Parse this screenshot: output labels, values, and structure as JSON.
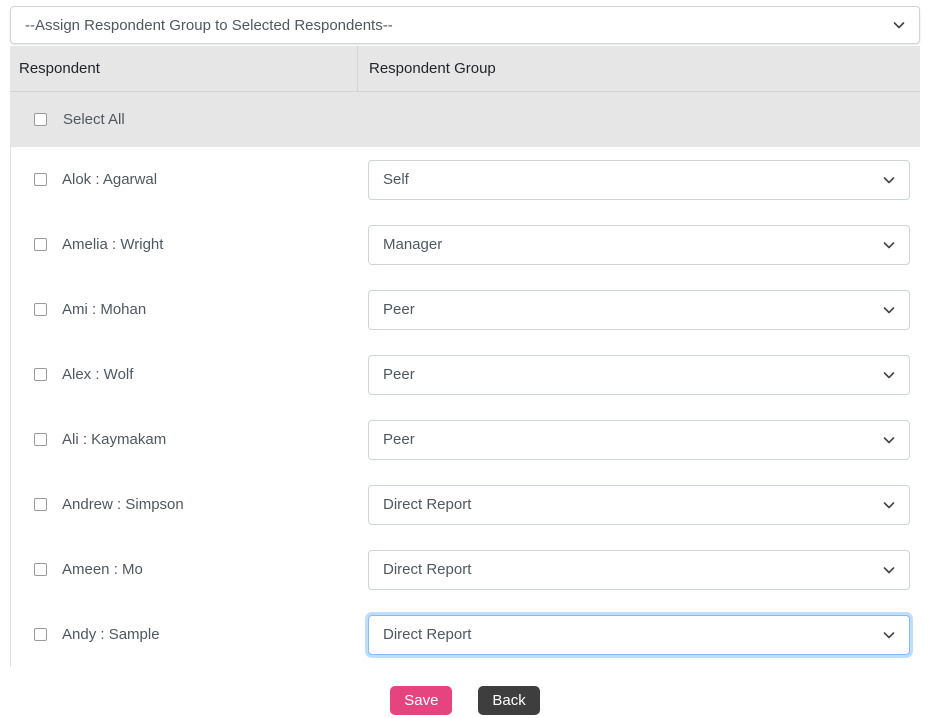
{
  "assign_select": {
    "value": "--Assign Respondent Group to Selected Respondents--",
    "icon": "chevron-down-icon"
  },
  "table": {
    "columns": {
      "respondent": "Respondent",
      "respondent_group": "Respondent Group"
    },
    "select_all_label": "Select All",
    "rows": [
      {
        "name": "Alok : Agarwal",
        "group": "Self",
        "checked": false,
        "focused": false
      },
      {
        "name": "Amelia : Wright",
        "group": "Manager",
        "checked": false,
        "focused": false
      },
      {
        "name": "Ami : Mohan",
        "group": "Peer",
        "checked": false,
        "focused": false
      },
      {
        "name": "Alex : Wolf",
        "group": "Peer",
        "checked": false,
        "focused": false
      },
      {
        "name": "Ali : Kaymakam",
        "group": "Peer",
        "checked": false,
        "focused": false
      },
      {
        "name": "Andrew : Simpson",
        "group": "Direct Report",
        "checked": false,
        "focused": false
      },
      {
        "name": "Ameen : Mo",
        "group": "Direct Report",
        "checked": false,
        "focused": false
      },
      {
        "name": "Andy : Sample",
        "group": "Direct Report",
        "checked": false,
        "focused": true
      }
    ]
  },
  "buttons": {
    "save": "Save",
    "back": "Back"
  },
  "colors": {
    "save_button": "#e5447f",
    "back_button": "#3e3e3e",
    "header_background": "#e6e6e6",
    "focus_border": "#80bdff"
  }
}
